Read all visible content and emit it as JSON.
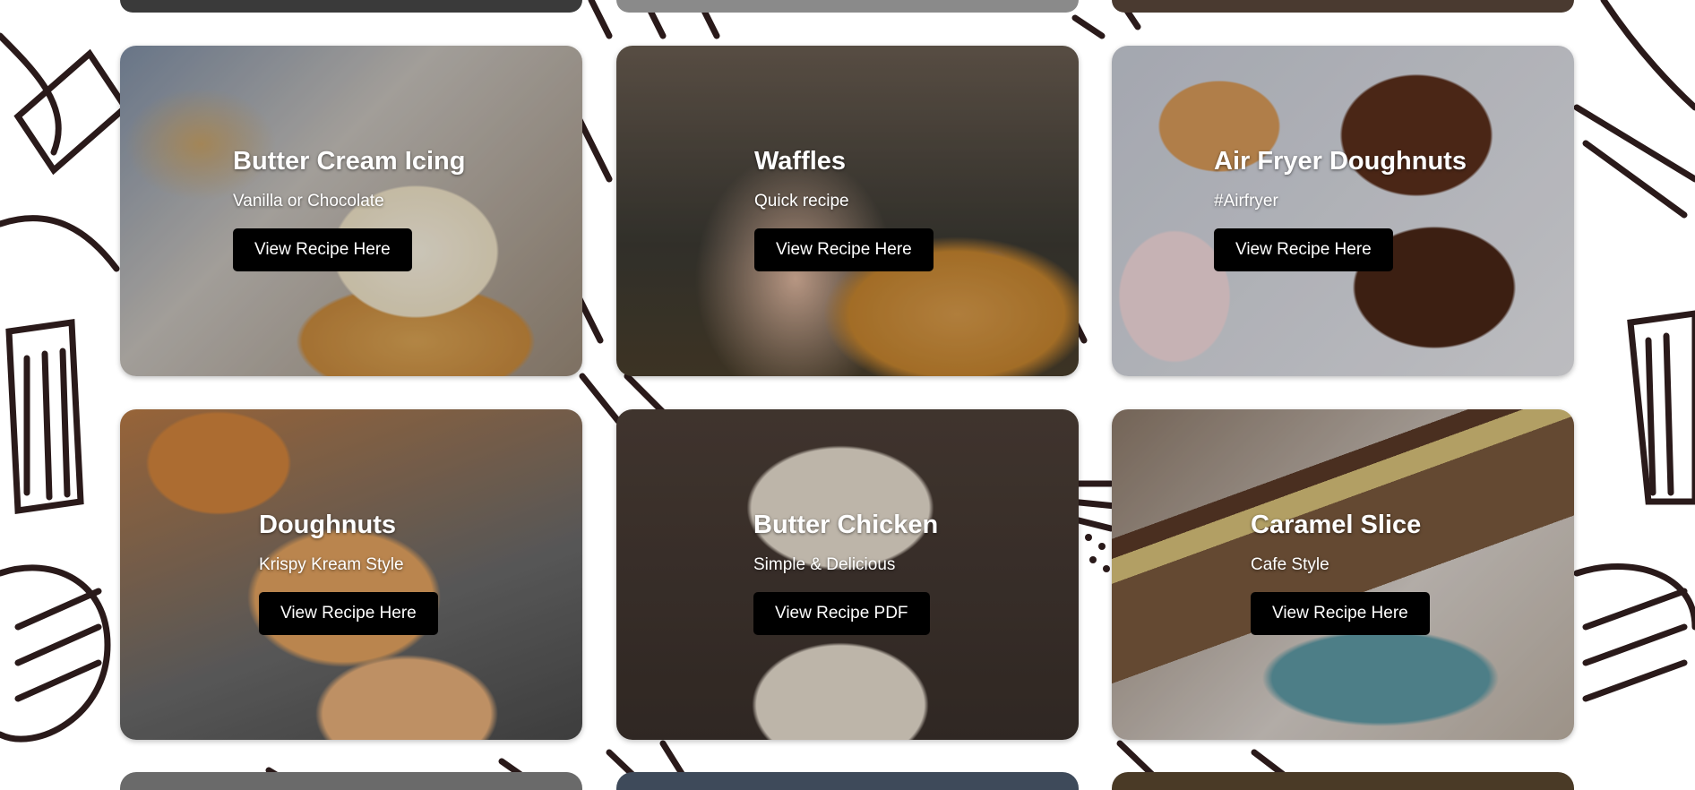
{
  "colors": {
    "button_bg": "#000000",
    "button_text": "#ffffff",
    "title_text": "#ffffff",
    "doodle_stroke": "#2a1a1a"
  },
  "cards": [
    {
      "title": "Butter Cream Icing",
      "subtitle": "Vanilla or Chocolate",
      "button": "View Recipe Here",
      "image": "cupcake-photo"
    },
    {
      "title": "Waffles",
      "subtitle": "Quick recipe",
      "button": "View Recipe Here",
      "image": "waffle-photo"
    },
    {
      "title": "Air Fryer Doughnuts",
      "subtitle": "#Airfryer",
      "button": "View Recipe Here",
      "image": "doughnuts-photo"
    },
    {
      "title": "Doughnuts",
      "subtitle": "Krispy Kream Style",
      "button": "View Recipe Here",
      "image": "krispy-doughnut-photo"
    },
    {
      "title": "Butter Chicken",
      "subtitle": "Simple & Delicious",
      "button": "View Recipe PDF",
      "image": "butter-chicken-photo"
    },
    {
      "title": "Caramel Slice",
      "subtitle": "Cafe Style",
      "button": "View Recipe Here",
      "image": "caramel-slice-photo"
    }
  ]
}
